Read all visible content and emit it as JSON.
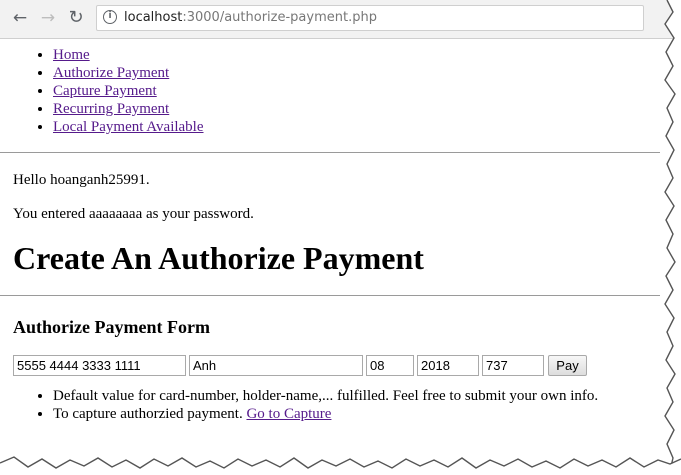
{
  "browser": {
    "url_host": "localhost",
    "url_path": ":3000/authorize-payment.php",
    "back_icon": "arrow-left-icon",
    "forward_icon": "arrow-right-icon",
    "reload_icon": "reload-icon",
    "info_icon": "info-icon"
  },
  "nav": {
    "items": [
      {
        "label": "Home"
      },
      {
        "label": "Authorize Payment"
      },
      {
        "label": "Capture Payment"
      },
      {
        "label": "Recurring Payment"
      },
      {
        "label": "Local Payment Available"
      }
    ]
  },
  "greeting": "Hello hoanganh25991.",
  "password_note": "You entered aaaaaaaa as your password.",
  "page_title": "Create An Authorize Payment",
  "form": {
    "title": "Authorize Payment Form",
    "card_number": "5555 4444 3333 1111",
    "holder_name": "Anh",
    "exp_month": "08",
    "exp_year": "2018",
    "cvv": "737",
    "submit_label": "Pay"
  },
  "notes": {
    "default_values": "Default value for card-number, holder-name,... fulfilled. Feel free to submit your own info.",
    "capture_text": "To capture authorzied payment. ",
    "capture_link": "Go to Capture"
  },
  "colors": {
    "link_visited": "#551a8b",
    "chrome_bg": "#f2f2f2"
  }
}
